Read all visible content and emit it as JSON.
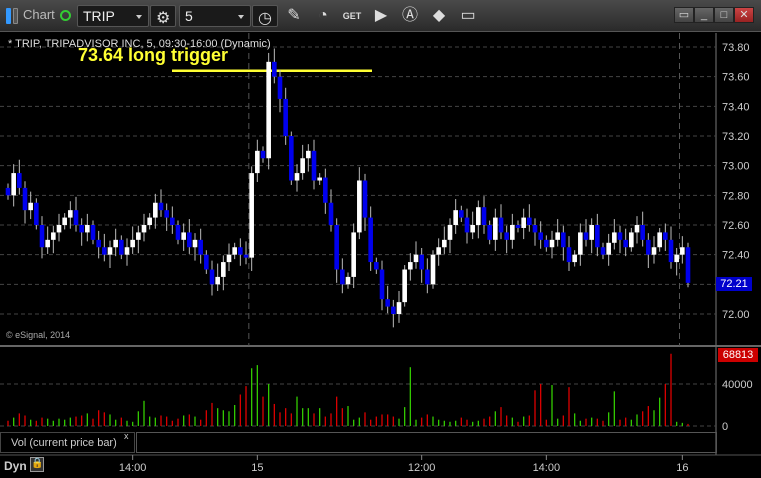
{
  "window": {
    "title": "Chart",
    "symbol": "TRIP",
    "interval": "5",
    "controls": [
      "restore-down",
      "minimize",
      "maximize",
      "close"
    ]
  },
  "toolbar": {
    "icons": [
      "gear-icon",
      "clock-icon",
      "pencil-icon",
      "study-icon",
      "get-icon",
      "play-icon",
      "alert-icon",
      "link-icon",
      "comment-icon"
    ]
  },
  "chart": {
    "header": "* TRIP, TRIPADVISOR INC, 5, 09:30-16:00 (Dynamic)",
    "annotation": "73.64 long trigger",
    "copyright": "© eSignal, 2014",
    "last_price": "72.21",
    "last_volume": "68813",
    "study_label": "Vol (current price bar)",
    "study_close": "x",
    "dyn_label": "Dyn"
  },
  "colors": {
    "up": "#ffffff",
    "down": "#0000ee",
    "vol_up": "#33cc00",
    "vol_down": "#dd0000",
    "annotation": "#ffff33",
    "last_price_bg": "#0000cc",
    "last_vol_bg": "#cc0000"
  },
  "chart_data": {
    "type": "candlestick",
    "price_ticks": [
      "72.00",
      "72.20",
      "72.40",
      "72.60",
      "72.80",
      "73.00",
      "73.20",
      "73.40",
      "73.60",
      "73.80"
    ],
    "ylim": [
      72.0,
      73.8
    ],
    "trigger_level": 73.64,
    "volume_ticks": [
      "0",
      "40000"
    ],
    "vol_ylim": [
      0,
      40000
    ],
    "time_ticks": [
      {
        "label": "14:00",
        "bar": 22
      },
      {
        "label": "15",
        "bar": 44
      },
      {
        "label": "12:00",
        "bar": 73
      },
      {
        "label": "14:00",
        "bar": 95
      },
      {
        "label": "16",
        "bar": 119
      }
    ],
    "day_breaks": [
      43,
      119
    ],
    "closes": [
      72.8,
      72.95,
      72.85,
      72.7,
      72.75,
      72.6,
      72.45,
      72.5,
      72.55,
      72.6,
      72.65,
      72.7,
      72.6,
      72.55,
      72.6,
      72.5,
      72.45,
      72.4,
      72.45,
      72.5,
      72.4,
      72.45,
      72.5,
      72.55,
      72.6,
      72.65,
      72.75,
      72.7,
      72.65,
      72.6,
      72.5,
      72.55,
      72.45,
      72.5,
      72.4,
      72.3,
      72.2,
      72.25,
      72.35,
      72.4,
      72.45,
      72.4,
      72.38,
      72.95,
      73.1,
      73.05,
      73.7,
      73.6,
      73.45,
      73.2,
      72.9,
      72.95,
      73.05,
      73.1,
      72.9,
      72.92,
      72.75,
      72.6,
      72.3,
      72.2,
      72.25,
      72.55,
      72.9,
      72.65,
      72.35,
      72.3,
      72.1,
      72.05,
      72.0,
      72.08,
      72.3,
      72.35,
      72.4,
      72.3,
      72.2,
      72.4,
      72.45,
      72.5,
      72.6,
      72.7,
      72.65,
      72.55,
      72.6,
      72.72,
      72.6,
      72.5,
      72.65,
      72.55,
      72.5,
      72.6,
      72.58,
      72.65,
      72.6,
      72.55,
      72.5,
      72.45,
      72.5,
      72.55,
      72.45,
      72.35,
      72.4,
      72.55,
      72.5,
      72.6,
      72.45,
      72.4,
      72.48,
      72.55,
      72.5,
      72.45,
      72.55,
      72.6,
      72.5,
      72.4,
      72.45,
      72.55,
      72.5,
      72.35,
      72.4,
      72.45,
      72.21
    ],
    "volumes": [
      5000,
      8000,
      12000,
      10000,
      6000,
      5000,
      8000,
      7000,
      5000,
      7000,
      6000,
      8000,
      9000,
      10000,
      12000,
      7000,
      15000,
      13000,
      11000,
      6000,
      8000,
      5000,
      4000,
      14000,
      24000,
      9000,
      8000,
      10000,
      9000,
      5000,
      7000,
      10000,
      11000,
      9000,
      6000,
      15000,
      22000,
      17000,
      15000,
      14000,
      20000,
      30000,
      38000,
      55000,
      58000,
      28000,
      40000,
      21000,
      13000,
      17000,
      12000,
      28000,
      17000,
      17000,
      12000,
      17000,
      9000,
      12000,
      28000,
      17000,
      19000,
      6000,
      8000,
      13000,
      6000,
      9000,
      11000,
      11000,
      9000,
      7000,
      18000,
      56000,
      6000,
      8000,
      11000,
      9000,
      6000,
      5000,
      4000,
      5000,
      8000,
      6000,
      4000,
      5000,
      7000,
      9000,
      14000,
      18000,
      10000,
      8000,
      4000,
      9000,
      10000,
      34000,
      40000,
      6000,
      39000,
      7000,
      10000,
      37000,
      12000,
      5000,
      7000,
      8000,
      7000,
      5000,
      13000,
      33000,
      6000,
      8000,
      6000,
      11000,
      14000,
      19000,
      15000,
      27000,
      40000,
      68813,
      4000,
      3000,
      2000
    ]
  }
}
